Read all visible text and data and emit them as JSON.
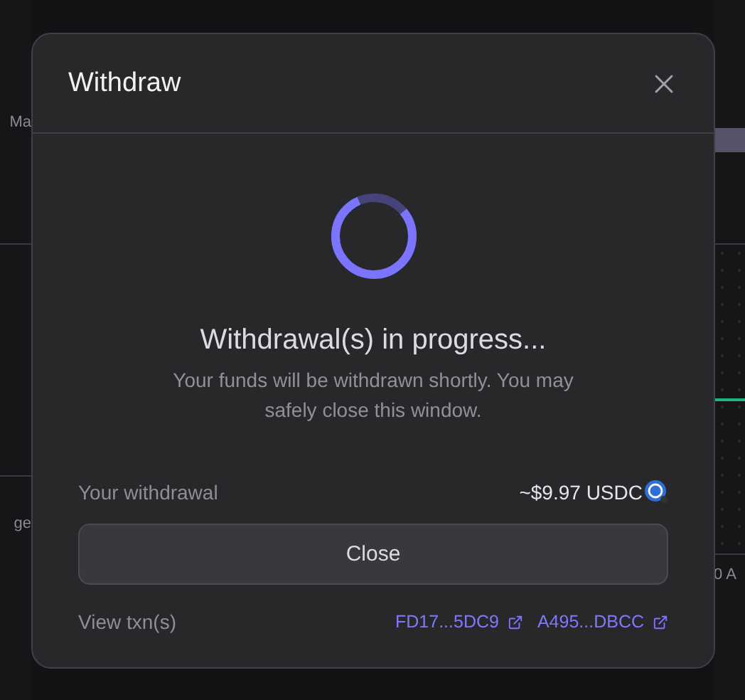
{
  "background": {
    "left_texts": [
      "Ma",
      "ge"
    ],
    "right_texts": [
      "0 A"
    ]
  },
  "dialog": {
    "title": "Withdraw",
    "status_title": "Withdrawal(s) in progress...",
    "status_message": "Your funds will be withdrawn shortly. You may safely close this window.",
    "summary": {
      "label": "Your withdrawal",
      "value": "~$9.97 USDC"
    },
    "close_button": "Close",
    "transactions": {
      "label": "View txn(s)",
      "links": [
        "FD17...5DC9",
        "A495...DBCC"
      ]
    }
  }
}
